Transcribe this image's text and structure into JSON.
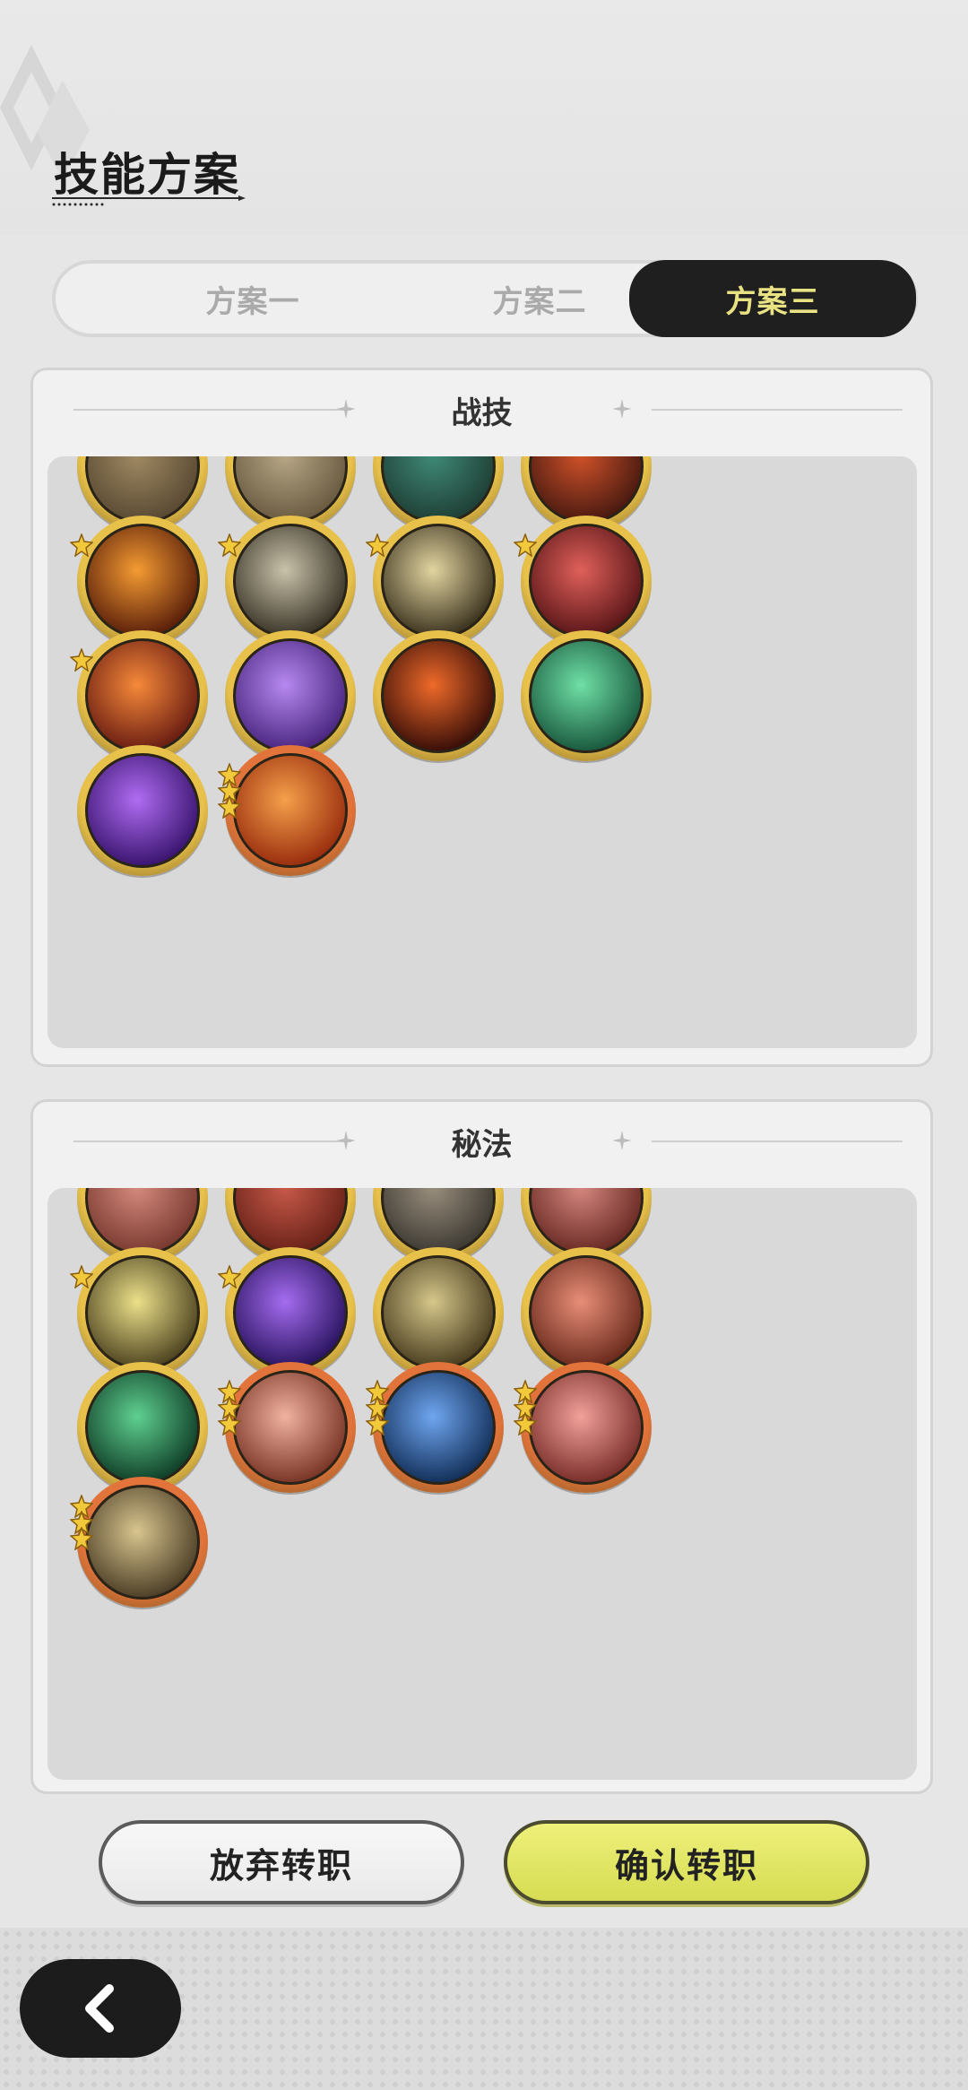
{
  "page_title": "技能方案",
  "tabs": [
    {
      "label": "方案一",
      "active": false
    },
    {
      "label": "方案二",
      "active": false
    },
    {
      "label": "方案三",
      "active": true
    }
  ],
  "sections": {
    "combat": {
      "title": "战技",
      "skills": [
        {
          "icon": "partial-bronze-skill",
          "tier": "gold",
          "stars": 0,
          "colors": [
            "#a08a63",
            "#5a4a33"
          ]
        },
        {
          "icon": "partial-light-skill",
          "tier": "gold",
          "stars": 0,
          "colors": [
            "#b8a888",
            "#6a5a40"
          ]
        },
        {
          "icon": "partial-teal-skill",
          "tier": "gold",
          "stars": 0,
          "colors": [
            "#3f8a77",
            "#1f3f36"
          ]
        },
        {
          "icon": "partial-flame-skill",
          "tier": "gold",
          "stars": 0,
          "colors": [
            "#d0522a",
            "#4a1a10"
          ]
        },
        {
          "icon": "fire-orb-skill",
          "tier": "gold",
          "stars": 1,
          "colors": [
            "#f49b32",
            "#5a1f0a"
          ]
        },
        {
          "icon": "wind-slash-skill",
          "tier": "gold",
          "stars": 1,
          "colors": [
            "#c9c2aa",
            "#3a3528"
          ]
        },
        {
          "icon": "lightning-slash-skill",
          "tier": "gold",
          "stars": 1,
          "colors": [
            "#e2d5a0",
            "#3d3420"
          ]
        },
        {
          "icon": "sword-raise-skill",
          "tier": "gold",
          "stars": 1,
          "colors": [
            "#e0605a",
            "#5a1618"
          ]
        },
        {
          "icon": "fire-sweep-skill",
          "tier": "gold",
          "stars": 1,
          "colors": [
            "#f6893a",
            "#6a1d12"
          ]
        },
        {
          "icon": "rose-magic-skill",
          "tier": "gold",
          "stars": 0,
          "colors": [
            "#b689f0",
            "#4a2680"
          ]
        },
        {
          "icon": "fire-crescent-skill",
          "tier": "gold",
          "stars": 0,
          "colors": [
            "#ef6a2a",
            "#3a0f08"
          ]
        },
        {
          "icon": "green-tornado-skill",
          "tier": "gold",
          "stars": 0,
          "colors": [
            "#6fe0a6",
            "#1a5a3f"
          ]
        },
        {
          "icon": "purple-ghost-skill",
          "tier": "gold",
          "stars": 0,
          "colors": [
            "#b06cf2",
            "#3a1570"
          ]
        },
        {
          "icon": "fire-figure-skill",
          "tier": "orange",
          "stars": 3,
          "colors": [
            "#f5a04a",
            "#9a2e0e"
          ]
        }
      ]
    },
    "secret": {
      "title": "秘法",
      "skills": [
        {
          "icon": "partial-pink-skill",
          "tier": "gold",
          "stars": 0,
          "colors": [
            "#d68a7e",
            "#7a3a30"
          ]
        },
        {
          "icon": "partial-red-skill",
          "tier": "gold",
          "stars": 0,
          "colors": [
            "#c85a4a",
            "#6a2218"
          ]
        },
        {
          "icon": "partial-star-skill",
          "tier": "gold",
          "stars": 0,
          "colors": [
            "#9a8f7e",
            "#3e3a33"
          ]
        },
        {
          "icon": "partial-rose-skill",
          "tier": "gold",
          "stars": 0,
          "colors": [
            "#d68880",
            "#6a2a24"
          ]
        },
        {
          "icon": "gold-aura-skill",
          "tier": "gold",
          "stars": 1,
          "colors": [
            "#ece08a",
            "#4e4420"
          ]
        },
        {
          "icon": "purple-flame-skill",
          "tier": "gold",
          "stars": 1,
          "colors": [
            "#a56cf0",
            "#2a1460"
          ]
        },
        {
          "icon": "eye-skill",
          "tier": "gold",
          "stars": 0,
          "colors": [
            "#d6c78a",
            "#4a3e20"
          ]
        },
        {
          "icon": "red-armor-skill",
          "tier": "gold",
          "stars": 0,
          "colors": [
            "#e88e78",
            "#6a2a1c"
          ]
        },
        {
          "icon": "green-leaf-skill",
          "tier": "gold",
          "stars": 0,
          "colors": [
            "#5fd090",
            "#103f28"
          ]
        },
        {
          "icon": "pink-swirl-skill",
          "tier": "orange",
          "stars": 3,
          "colors": [
            "#f1b2a0",
            "#7a3526"
          ]
        },
        {
          "icon": "blue-crystal-skill",
          "tier": "orange",
          "stars": 3,
          "colors": [
            "#6fa6f0",
            "#13305a"
          ]
        },
        {
          "icon": "pink-flower-skill",
          "tier": "orange",
          "stars": 3,
          "colors": [
            "#f2a09a",
            "#7a2f2a"
          ]
        },
        {
          "icon": "shield-figure-skill",
          "tier": "orange",
          "stars": 3,
          "colors": [
            "#d8c58e",
            "#4e4028"
          ]
        }
      ]
    }
  },
  "buttons": {
    "abandon": "放弃转职",
    "confirm": "确认转职"
  },
  "colors": {
    "active_tab_bg": "#1f1f1f",
    "active_tab_text": "#e8e283",
    "confirm_bg": "#dde062",
    "gold_ring": "#e7c14a",
    "orange_ring": "#e2733a"
  }
}
